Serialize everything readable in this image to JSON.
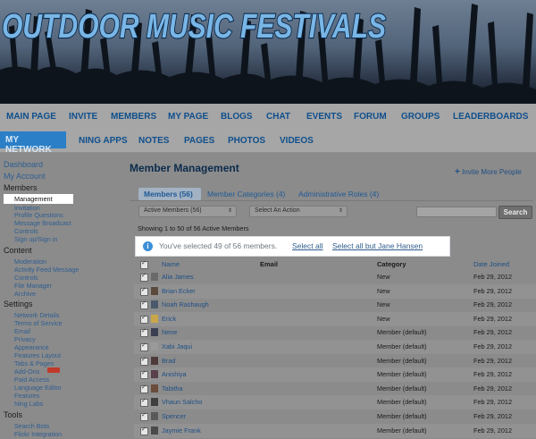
{
  "banner": {
    "title": "OUTDOOR MUSIC FESTIVALS"
  },
  "nav_main": [
    "MAIN PAGE",
    "INVITE",
    "MEMBERS",
    "MY PAGE",
    "BLOGS",
    "CHAT",
    "EVENTS",
    "FORUM",
    "GROUPS",
    "LEADERBOARDS"
  ],
  "nav_sub": [
    "MY NETWORK",
    "NING APPS",
    "NOTES",
    "PAGES",
    "PHOTOS",
    "VIDEOS"
  ],
  "sidebar": {
    "dashboard": "Dashboard",
    "my_account": "My Account",
    "members_head": "Members",
    "members_items": [
      "Management",
      "Invitation",
      "Profile Questions",
      "Message Broadcast",
      "Controls",
      "Sign up/Sign in"
    ],
    "content_head": "Content",
    "content_items": [
      "Moderation",
      "Activity Feed Message",
      "Controls",
      "File Manager",
      "Archive"
    ],
    "settings_head": "Settings",
    "settings_items": [
      "Network Details",
      "Terms of Service",
      "Email",
      "Privacy",
      "Appearance",
      "Features Layout",
      "Tabs & Pages",
      "Add-Ons",
      "Paid Access",
      "Language Editor",
      "Features",
      "Ning Labs"
    ],
    "tools_head": "Tools",
    "tools_items": [
      "Search Bots",
      "Flickr Integration"
    ],
    "new_badge_color": "#c0392b"
  },
  "main": {
    "title": "Member Management",
    "invite_more": "Invite More People",
    "tabs": [
      "Members (56)",
      "Member Categories (4)",
      "Administrative Roles (4)"
    ],
    "filter_select": "Active Members (56)",
    "action_select": "Select An Action",
    "search_button": "Search",
    "search_value": "",
    "showing": "Showing 1 to 50 of 56 Active Members",
    "notice": {
      "text": "You've selected 49 of 56 members.",
      "select_all": "Select all",
      "select_all_but": "Select all but Jane Hansen"
    },
    "columns": [
      "Name",
      "Email",
      "Category",
      "Date Joined"
    ],
    "rows": [
      {
        "name": "Alia James",
        "category": "New",
        "date": "Feb 29, 2012",
        "avatar": "#6a6a6a"
      },
      {
        "name": "Brian Ecker",
        "category": "New",
        "date": "Feb 29, 2012",
        "avatar": "#5b4a3c"
      },
      {
        "name": "Noah Rashaugh",
        "category": "New",
        "date": "Feb 29, 2012",
        "avatar": "#4a5a6a"
      },
      {
        "name": "Erick",
        "category": "New",
        "date": "Feb 29, 2012",
        "avatar": "#c9a64a"
      },
      {
        "name": "Nene",
        "category": "Member (default)",
        "date": "Feb 29, 2012",
        "avatar": "#3a3f52"
      },
      {
        "name": "Xabi Jaqui",
        "category": "Member (default)",
        "date": "Feb 29, 2012",
        "avatar": "#9a9a9a"
      },
      {
        "name": "Brad",
        "category": "Member (default)",
        "date": "Feb 29, 2012",
        "avatar": "#4f3a3a"
      },
      {
        "name": "Anishiya",
        "category": "Member (default)",
        "date": "Feb 29, 2012",
        "avatar": "#5a3f4d"
      },
      {
        "name": "Tabitha",
        "category": "Member (default)",
        "date": "Feb 29, 2012",
        "avatar": "#6b4b3a"
      },
      {
        "name": "Vhaun Salcho",
        "category": "Member (default)",
        "date": "Feb 29, 2012",
        "avatar": "#3f3f3f"
      },
      {
        "name": "Spencer",
        "category": "Member (default)",
        "date": "Feb 29, 2012",
        "avatar": "#5a5a5a"
      },
      {
        "name": "Jaymie Frank",
        "category": "Member (default)",
        "date": "Feb 29, 2012",
        "avatar": "#4a4a4a"
      }
    ]
  },
  "colors": {
    "nav_text": "#0f4f8c",
    "accent_blue": "#2b7fc6",
    "notice_bg": "#ffffff"
  }
}
